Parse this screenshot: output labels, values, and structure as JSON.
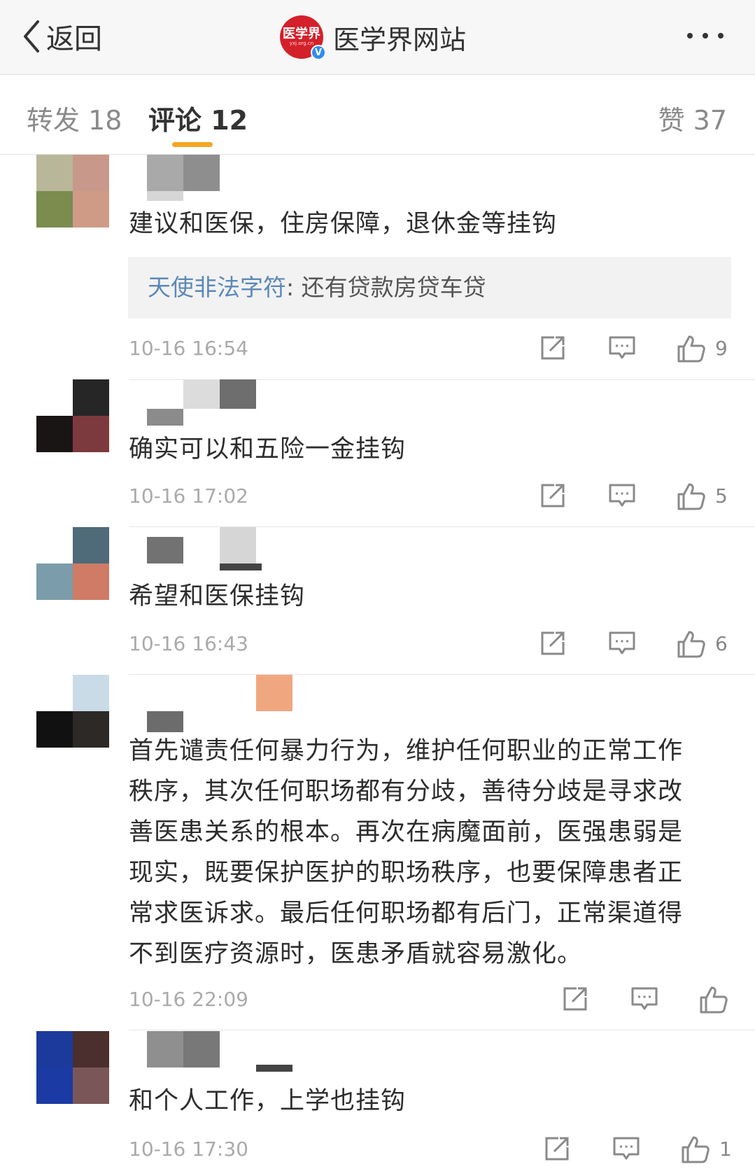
{
  "nav": {
    "back_label": "返回",
    "account_name": "医学界网站",
    "logo_text": "医学界",
    "logo_sub": "yxj.org.cn",
    "verified_mark": "V",
    "back_icon": "chevron-left-icon",
    "more_icon": "more-dots-icon"
  },
  "tabs": {
    "forward": "转发 18",
    "comment": "评论 12",
    "like": "赞 37"
  },
  "colors": {
    "accent": "#f5a623",
    "link": "#5b88b8",
    "brand": "#d3202a",
    "verified": "#2f8cf2"
  },
  "comments": [
    {
      "text": "建议和医保，住房保障，退休金等挂钩",
      "reply": {
        "name": "天使非法字符",
        "text": ": 还有贷款房贷车贷"
      },
      "time": "10-16 16:54",
      "likes": "9"
    },
    {
      "text": "确实可以和五险一金挂钩",
      "time": "10-16 17:02",
      "likes": "5"
    },
    {
      "text": "希望和医保挂钩",
      "time": "10-16 16:43",
      "likes": "6"
    },
    {
      "lines": [
        "首先谴责任何暴力行为，维护任何职业的正常工作",
        "秩序，其次任何职场都有分歧，善待分歧是寻求改",
        "善医患关系的根本。再次在病魔面前，医强患弱是",
        "现实，既要保护医护的职场秩序，也要保障患者正",
        "常求医诉求。最后任何职场都有后门，正常渠道得",
        "不到医疗资源时，医患矛盾就容易激化。"
      ],
      "time": "10-16 22:09",
      "likes": ""
    },
    {
      "text": "和个人工作，上学也挂钩",
      "time": "10-16 17:30",
      "likes": "1"
    }
  ],
  "action_icons": [
    "forward-icon",
    "reply-icon",
    "like-icon"
  ]
}
